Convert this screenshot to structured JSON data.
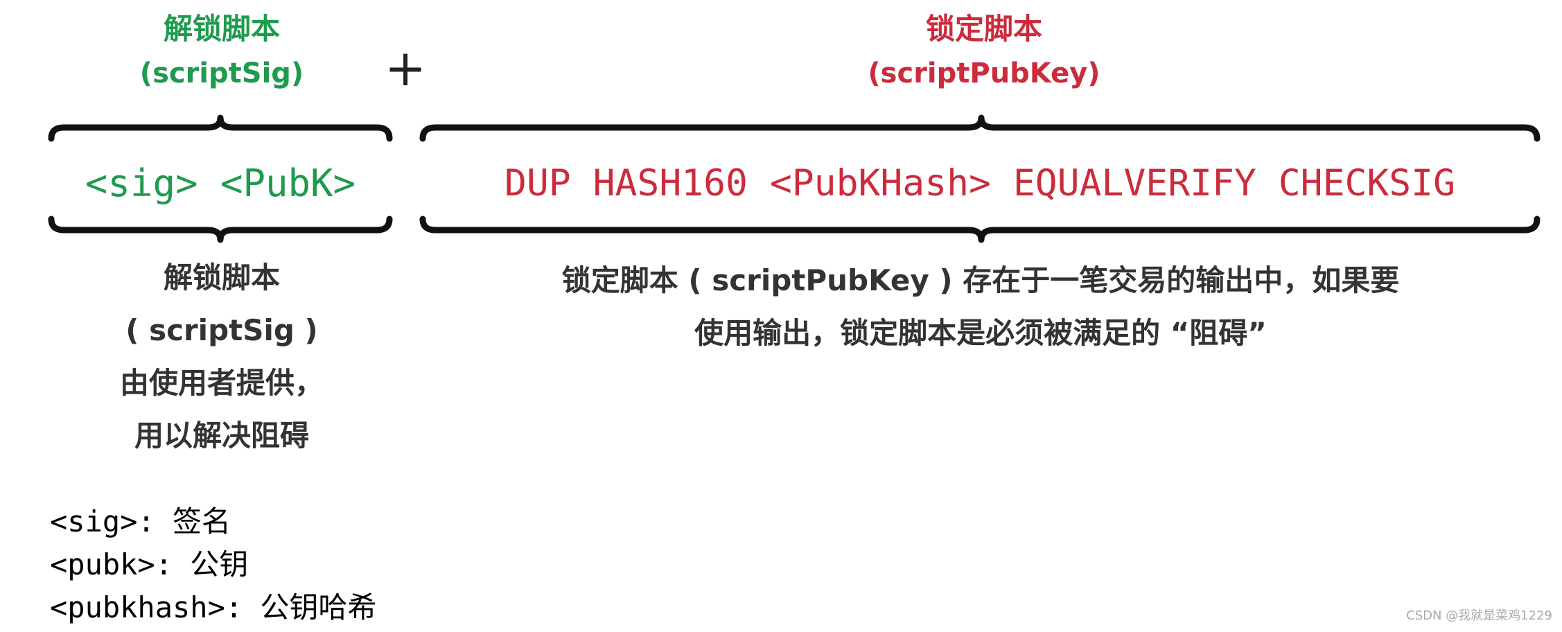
{
  "unlocking": {
    "title": "解锁脚本",
    "subtitle": "(scriptSig)",
    "code": "<sig> <PubK>",
    "description_lines": [
      "解锁脚本",
      "( scriptSig )",
      "由使用者提供，",
      "用以解决阻碍"
    ]
  },
  "plus_sign": "+",
  "locking": {
    "title": "锁定脚本",
    "subtitle": "(scriptPubKey)",
    "code": "DUP HASH160 <PubKHash> EQUALVERIFY CHECKSIG",
    "description_lines": [
      "锁定脚本 ( scriptPubKey ) 存在于一笔交易的输出中，如果要",
      "使用输出，锁定脚本是必须被满足的 “阻碍”"
    ]
  },
  "glossary": [
    "<sig>: 签名",
    "<pubk>: 公钥",
    "<pubkhash>: 公钥哈希"
  ],
  "watermark": "CSDN @我就是菜鸡1229",
  "colors": {
    "unlocking": "#1f9a4e",
    "locking": "#cc2b3c",
    "brace": "#111111"
  }
}
